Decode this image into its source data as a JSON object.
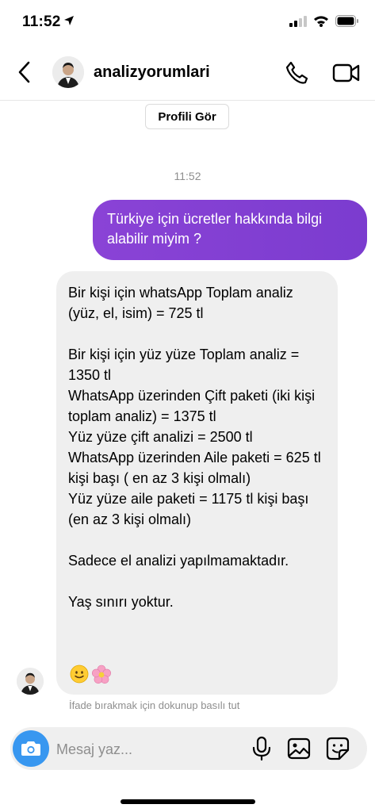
{
  "status_bar": {
    "time": "11:52"
  },
  "header": {
    "username": "analizyorumlari"
  },
  "profile_button": {
    "label": "Profili Gör"
  },
  "thread": {
    "timestamp": "11:52",
    "sent_message": "Türkiye için ücretler hakkında bilgi alabilir miyim ?",
    "received_message": "Bir kişi için whatsApp Toplam analiz (yüz, el, isim) = 725 tl\n\nBir kişi için yüz yüze Toplam analiz = 1350 tl\nWhatsApp üzerinden Çift paketi (iki kişi toplam analiz) = 1375 tl\nYüz yüze çift analizi = 2500 tl\nWhatsApp üzerinden Aile paketi = 625 tl kişi başı ( en az 3 kişi olmalı)\nYüz yüze aile paketi = 1175 tl kişi başı (en az 3 kişi olmalı)\n\nSadece el analizi yapılmamaktadır.\n\nYaş sınırı yoktur.",
    "reaction_hint": "İfade bırakmak için dokunup basılı tut"
  },
  "composer": {
    "placeholder": "Mesaj yaz..."
  },
  "colors": {
    "sent_bubble": "#8a43d6",
    "received_bubble": "#efefef",
    "camera_button": "#3897f0",
    "secondary_text": "#8e8e8e"
  },
  "icons": [
    "location-arrow-icon",
    "signal-icon",
    "wifi-icon",
    "battery-icon",
    "back-chevron-icon",
    "phone-icon",
    "video-camera-icon",
    "camera-icon",
    "microphone-icon",
    "gallery-icon",
    "sticker-icon",
    "smile-emoji-icon",
    "flower-emoji-icon"
  ]
}
